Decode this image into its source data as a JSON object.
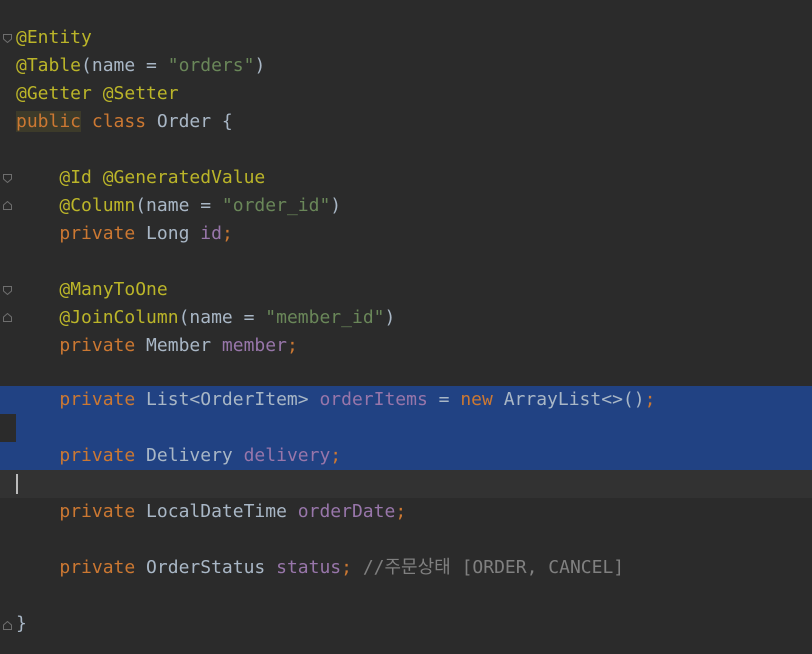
{
  "editor": {
    "lines": {
      "l1": {
        "a1": "@Entity"
      },
      "l2": {
        "a1": "@Table",
        "p1": "(name = ",
        "s1": "\"orders\"",
        "p2": ")"
      },
      "l3": {
        "a1": "@Getter @Setter"
      },
      "l4": {
        "k1": "public",
        "sp": " ",
        "k2": "class",
        "t1": " Order {"
      },
      "l6": {
        "indent": "    ",
        "a1": "@Id @GeneratedValue"
      },
      "l7": {
        "indent": "    ",
        "a1": "@Column",
        "p1": "(name = ",
        "s1": "\"order_id\"",
        "p2": ")"
      },
      "l8": {
        "indent": "    ",
        "k1": "private",
        "t1": " Long ",
        "f1": "id",
        "k2": ";"
      },
      "l10": {
        "indent": "    ",
        "a1": "@ManyToOne"
      },
      "l11": {
        "indent": "    ",
        "a1": "@JoinColumn",
        "p1": "(name = ",
        "s1": "\"member_id\"",
        "p2": ")"
      },
      "l12": {
        "indent": "    ",
        "k1": "private",
        "t1": " Member ",
        "f1": "member",
        "k2": ";"
      },
      "l14": {
        "indent": "    ",
        "k1": "private",
        "t1": " List<OrderItem> ",
        "f1": "orderItems",
        "t2": " = ",
        "k2": "new",
        "t3": " ArrayList<>()",
        "k3": ";"
      },
      "l16": {
        "indent": "    ",
        "k1": "private",
        "t1": " Delivery ",
        "f1": "delivery",
        "k2": ";"
      },
      "l18": {
        "indent": "    ",
        "k1": "private",
        "t1": " LocalDateTime ",
        "f1": "orderDate",
        "k2": ";"
      },
      "l20": {
        "indent": "    ",
        "k1": "private",
        "t1": " OrderStatus ",
        "f1": "status",
        "k2": ";",
        "c1": " //주문상태 [ORDER, CANCEL]"
      },
      "l22": {
        "t1": "}"
      }
    }
  },
  "colors": {
    "background": "#2b2b2b",
    "selection": "#214283",
    "caret_line": "#323232",
    "annotation": "#bbb529",
    "keyword": "#cc7832",
    "string": "#6a8759",
    "field": "#9876aa",
    "comment": "#808080",
    "text": "#a9b7c6"
  },
  "icons": {
    "fold_start": "fold-open-icon",
    "fold_end": "fold-close-icon"
  }
}
